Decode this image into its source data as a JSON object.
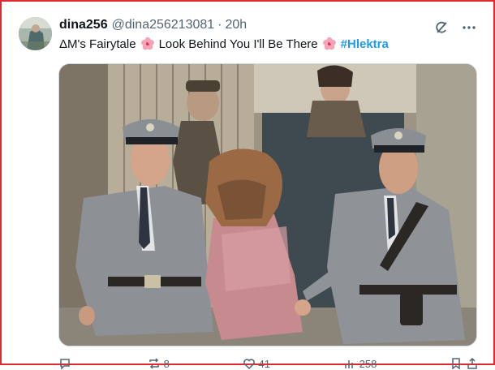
{
  "tweet": {
    "display_name": "dina256",
    "handle": "@dina256213081",
    "separator": "·",
    "time": "20h",
    "text_part1": "ΔM's Fairytale",
    "text_part2": "Look Behind You I'll Be There",
    "hashtag": "#Hlektra"
  },
  "icons": {
    "grok": "grok-icon",
    "more": "more-icon",
    "flower": "hibiscus-emoji"
  },
  "stats": {
    "reply": "",
    "retweet": "8",
    "like": "41",
    "views": "258"
  },
  "colors": {
    "accent": "#1d9bf0",
    "border_highlight": "#e0282e",
    "muted": "#536471"
  }
}
